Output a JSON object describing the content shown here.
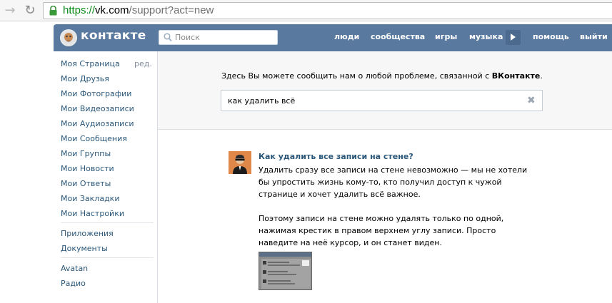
{
  "browser": {
    "url_scheme": "https://",
    "url_host": "vk.com",
    "url_path": "/support?act=new"
  },
  "header": {
    "logo_text": "контакте",
    "search_placeholder": "Поиск",
    "nav": [
      "люди",
      "сообщества",
      "игры",
      "музыка",
      "помощь",
      "выйти"
    ]
  },
  "sidebar": {
    "items": [
      "Моя Страница",
      "Мои Друзья",
      "Мои Фотографии",
      "Мои Видеозаписи",
      "Мои Аудиозаписи",
      "Мои Сообщения",
      "Мои Группы",
      "Мои Новости",
      "Мои Ответы",
      "Мои Закладки",
      "Мои Настройки"
    ],
    "edit_label": "ред.",
    "apps": [
      "Приложения",
      "Документы"
    ],
    "extra": [
      "Avatan",
      "Радио"
    ]
  },
  "help": {
    "prompt": "Здесь Вы можете сообщить нам о любой проблеме, связанной с ",
    "prompt_brand": "ВКонтакте",
    "prompt_end": ".",
    "query": "как удалить всё"
  },
  "answer": {
    "title": "Как удалить все записи на стене?",
    "p1": "Удалить сразу все записи на стене невозможно — мы не хотели бы упростить жизнь кому-то, кто получил доступ к чужой странице и хочет удалить всё важное.",
    "p2": "Поэтому записи на стене можно удалять только по одной, нажимая крестик в правом верхнем углу записи. Просто наведите на неё курсор, и он станет виден."
  },
  "colors": {
    "header_bg": "#59799f",
    "link": "#2b587a",
    "url_green": "#0b8a1a"
  },
  "icons": [
    "back-arrow-icon",
    "reload-icon",
    "lock-icon",
    "search-icon",
    "play-icon",
    "clear-icon"
  ]
}
